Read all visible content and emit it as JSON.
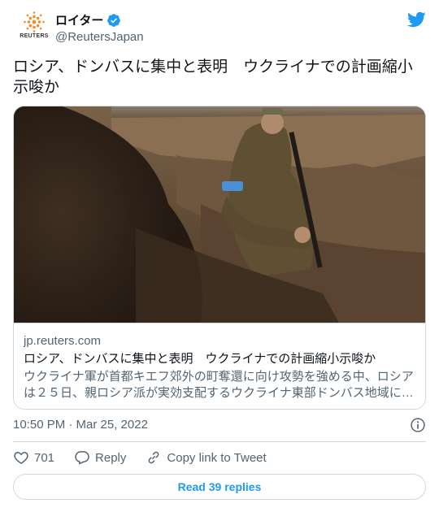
{
  "author": {
    "display_name": "ロイター",
    "handle": "@ReutersJapan",
    "avatar_brand": "REUTERS",
    "verified": true
  },
  "tweet": {
    "text": "ロシア、ドンバスに集中と表明　ウクライナでの計画縮小示唆か"
  },
  "card": {
    "domain": "jp.reuters.com",
    "title": "ロシア、ドンバスに集中と表明　ウクライナでの計画縮小示唆か",
    "description": "ウクライナ軍が首都キエフ郊外の町奪還に向け攻勢を強める中、ロシアは２５日、親ロシア派が実効支配するウクライナ東部ドンバス地域に…"
  },
  "meta": {
    "timestamp": "10:50 PM · Mar 25, 2022"
  },
  "actions": {
    "like_count": "701",
    "reply_label": "Reply",
    "copy_label": "Copy link to Tweet"
  },
  "read_replies_label": "Read 39 replies",
  "colors": {
    "accent": "#1d9bf0",
    "secondary_text": "#536471",
    "border": "#cfd9de",
    "reuters_orange": "#f28c28"
  },
  "icons": [
    "reuters-logo-icon",
    "verified-badge-icon",
    "twitter-bird-icon",
    "info-icon",
    "heart-icon",
    "reply-icon",
    "link-icon"
  ]
}
